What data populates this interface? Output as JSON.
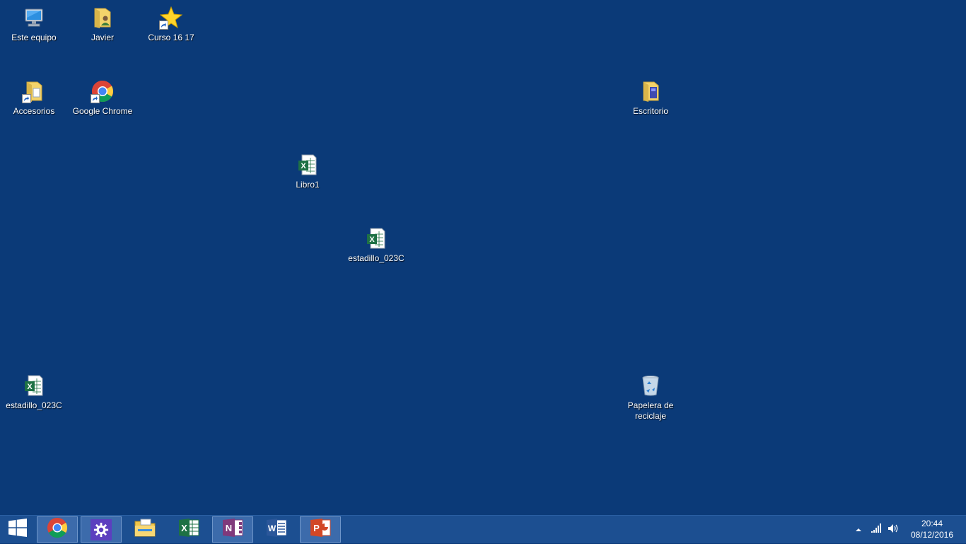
{
  "desktop": {
    "icons": [
      {
        "label": "Este equipo",
        "icon": "computer-icon"
      },
      {
        "label": "Javier",
        "icon": "user-folder-icon"
      },
      {
        "label": "Curso 16 17",
        "icon": "star-shortcut-icon"
      },
      {
        "label": "Accesorios",
        "icon": "folder-shortcut-icon"
      },
      {
        "label": "Google Chrome",
        "icon": "chrome-icon"
      },
      {
        "label": "Escritorio",
        "icon": "folder-icon"
      },
      {
        "label": "Libro1",
        "icon": "excel-file-icon"
      },
      {
        "label": "estadillo_023C",
        "icon": "excel-file-icon"
      },
      {
        "label": "estadillo_023C",
        "icon": "excel-file-icon"
      },
      {
        "label": "Papelera de\nreciclaje",
        "icon": "recycle-bin-icon"
      }
    ]
  },
  "taskbar": {
    "buttons": [
      {
        "name": "start",
        "icon": "windows-logo-icon"
      },
      {
        "name": "chrome",
        "icon": "chrome-icon",
        "active": true
      },
      {
        "name": "settings",
        "icon": "gear-icon",
        "active": true
      },
      {
        "name": "file-explorer",
        "icon": "file-explorer-icon"
      },
      {
        "name": "excel",
        "icon": "excel-icon"
      },
      {
        "name": "onenote",
        "icon": "onenote-icon",
        "active": true
      },
      {
        "name": "word",
        "icon": "word-icon"
      },
      {
        "name": "powerpoint",
        "icon": "powerpoint-icon",
        "active": true
      }
    ],
    "clock": {
      "time": "20:44",
      "date": "08/12/2016"
    }
  },
  "colors": {
    "desktop_bg": "#0b3a78",
    "taskbar_bg": "#1c4f91",
    "excel_green": "#1e7145",
    "onenote_purple": "#80397b",
    "word_blue": "#2b579a",
    "powerpoint_orange": "#d24726"
  }
}
